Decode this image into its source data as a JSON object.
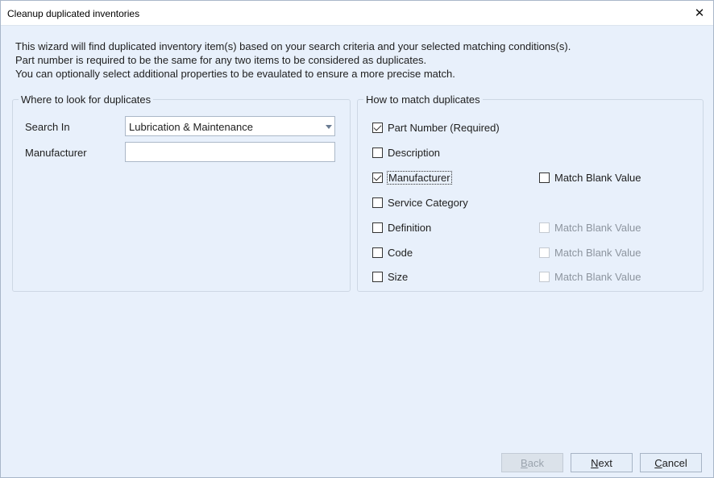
{
  "window": {
    "title": "Cleanup duplicated inventories",
    "close_glyph": "✕"
  },
  "intro": {
    "line1": "This wizard will find duplicated inventory item(s) based on your search criteria and your selected matching conditions(s).",
    "line2": "Part number is required to be the same for any two items to be considered as duplicates.",
    "line3": "You can optionally select additional properties to be evaulated to ensure a more precise match."
  },
  "left_group": {
    "legend": "Where to look for duplicates",
    "search_in_label": "Search In",
    "search_in_value": "Lubrication & Maintenance",
    "manufacturer_label": "Manufacturer",
    "manufacturer_value": ""
  },
  "right_group": {
    "legend": "How to match duplicates",
    "items": [
      {
        "label": "Part Number (Required)",
        "checked": true
      },
      {
        "label": "Description",
        "checked": false
      },
      {
        "label": "Manufacturer",
        "checked": true
      },
      {
        "label": "Service Category",
        "checked": false
      },
      {
        "label": "Definition",
        "checked": false
      },
      {
        "label": "Code",
        "checked": false
      },
      {
        "label": "Size",
        "checked": false
      }
    ],
    "blank": [
      {
        "label": "Match Blank Value",
        "checked": false,
        "enabled": true
      },
      {
        "label": "Match Blank Value",
        "checked": false,
        "enabled": false
      },
      {
        "label": "Match Blank Value",
        "checked": false,
        "enabled": false
      },
      {
        "label": "Match Blank Value",
        "checked": false,
        "enabled": false
      }
    ]
  },
  "buttons": {
    "back": {
      "first": "B",
      "rest": "ack",
      "enabled": false
    },
    "next": {
      "first": "N",
      "rest": "ext",
      "enabled": true
    },
    "cancel": {
      "first": "C",
      "rest": "ancel",
      "enabled": true
    }
  }
}
